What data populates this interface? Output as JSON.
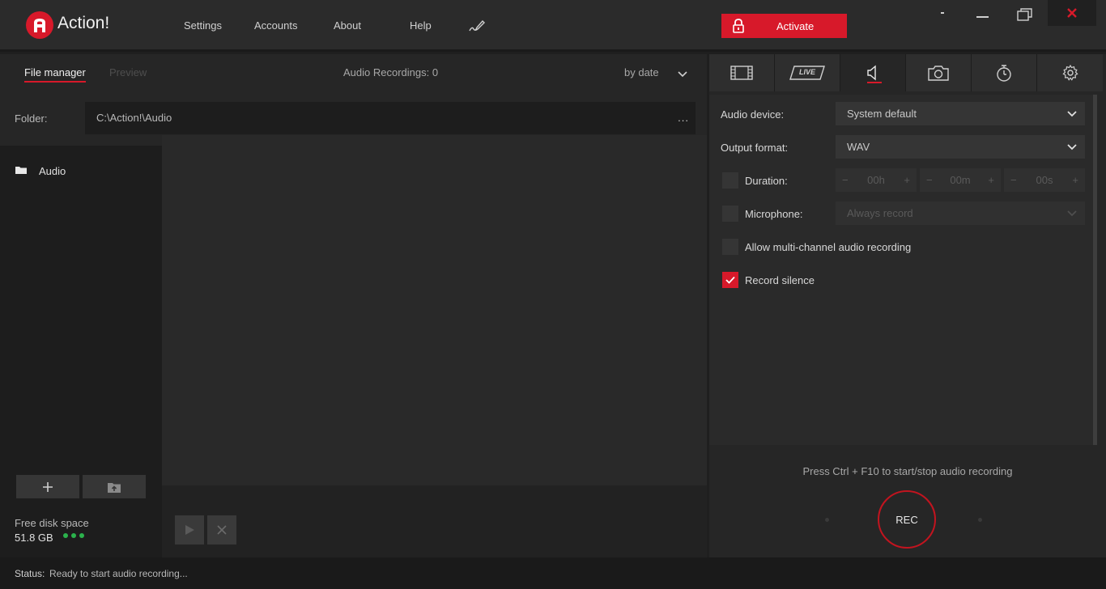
{
  "app": {
    "title": "Action!"
  },
  "menu": {
    "settings": "Settings",
    "accounts": "Accounts",
    "about": "About",
    "help": "Help"
  },
  "activate_label": "Activate",
  "left": {
    "tabs": {
      "file_manager": "File manager",
      "preview": "Preview"
    },
    "recordings_count": "Audio Recordings: 0",
    "sort": "by date",
    "folder_label": "Folder:",
    "folder_path": "C:\\Action!\\Audio",
    "folder_more": "...",
    "tree_items": [
      "Audio"
    ],
    "disk_label": "Free disk space",
    "disk_value": "51.8 GB"
  },
  "right": {
    "tabs": [
      "video-tab",
      "live-tab",
      "audio-tab",
      "screenshot-tab",
      "timer-tab",
      "settings-tab"
    ],
    "live_label": "LIVE",
    "audio_device_label": "Audio device:",
    "audio_device_value": "System default",
    "output_format_label": "Output format:",
    "output_format_value": "WAV",
    "duration_label": "Duration:",
    "duration_h": "00h",
    "duration_m": "00m",
    "duration_s": "00s",
    "minus": "−",
    "plus": "+",
    "microphone_label": "Microphone:",
    "microphone_value": "Always record",
    "multichannel_label": "Allow multi-channel audio recording",
    "silence_label": "Record silence",
    "hint": "Press Ctrl + F10 to start/stop audio recording",
    "rec_label": "REC"
  },
  "status": {
    "label": "Status:",
    "value": "Ready to start audio recording..."
  },
  "colors": {
    "accent": "#d7192a",
    "disk_ok": "#2bb24c"
  }
}
